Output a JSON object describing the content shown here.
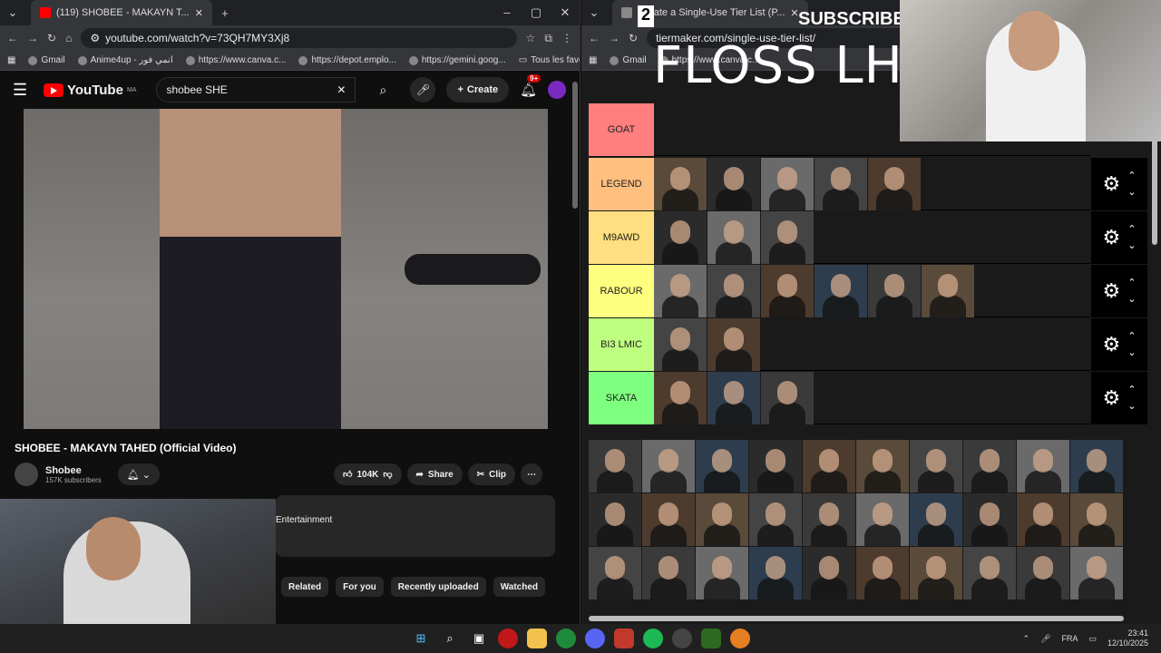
{
  "left_browser": {
    "tab_title": "(119) SHOBEE - MAKAYN T...",
    "url": "youtube.com/watch?v=73QH7MY3Xj8",
    "bookmarks": [
      "Gmail",
      "Anime4up - انمي فور",
      "https://www.canva.c...",
      "https://depot.emplo...",
      "https://gemini.goog...",
      "Tous les favoris"
    ]
  },
  "youtube": {
    "logo": "YouTube",
    "region": "MA",
    "search_value": "shobee SHE",
    "create_label": "Create",
    "notif_count": "9+",
    "video_title": "SHOBEE - MAKAYN TAHED (Official Video)",
    "channel_name": "Shobee",
    "subscribers": "157K subscribers",
    "likes": "104K",
    "share_label": "Share",
    "clip_label": "Clip",
    "description": "Entertainment",
    "chips": [
      "Related",
      "For you",
      "Recently uploaded",
      "Watched"
    ]
  },
  "right_browser": {
    "tab_title": "Create a Single-Use Tier List (P...",
    "url": "tiermaker.com/single-use-tier-list/",
    "bookmarks": [
      "Gmail",
      "https://www.canva.c..."
    ]
  },
  "overlay": {
    "number": "2",
    "subscribe": "SUBSCRIBE",
    "banner": "FLOSS LHS"
  },
  "tiers": [
    {
      "label": "GOAT",
      "color": "#ff7f7f",
      "count": 0
    },
    {
      "label": "LEGEND",
      "color": "#ffbf7f",
      "count": 5
    },
    {
      "label": "M9AWD",
      "color": "#ffdf7f",
      "count": 3
    },
    {
      "label": "RABOUR",
      "color": "#ffff7f",
      "count": 6
    },
    {
      "label": "BI3 LMIC",
      "color": "#bfff7f",
      "count": 2
    },
    {
      "label": "SKATA",
      "color": "#7fff7f",
      "count": 3
    }
  ],
  "pool_count": 30,
  "taskbar": {
    "lang": "FRA",
    "time": "23:41",
    "date": "12/10/2025"
  },
  "icons": [
    "hamburger-icon",
    "search-icon",
    "mic-icon",
    "bell-icon",
    "like-icon",
    "dislike-icon",
    "share-icon",
    "clip-icon",
    "gear-icon",
    "chevron-up-icon",
    "chevron-down-icon"
  ]
}
